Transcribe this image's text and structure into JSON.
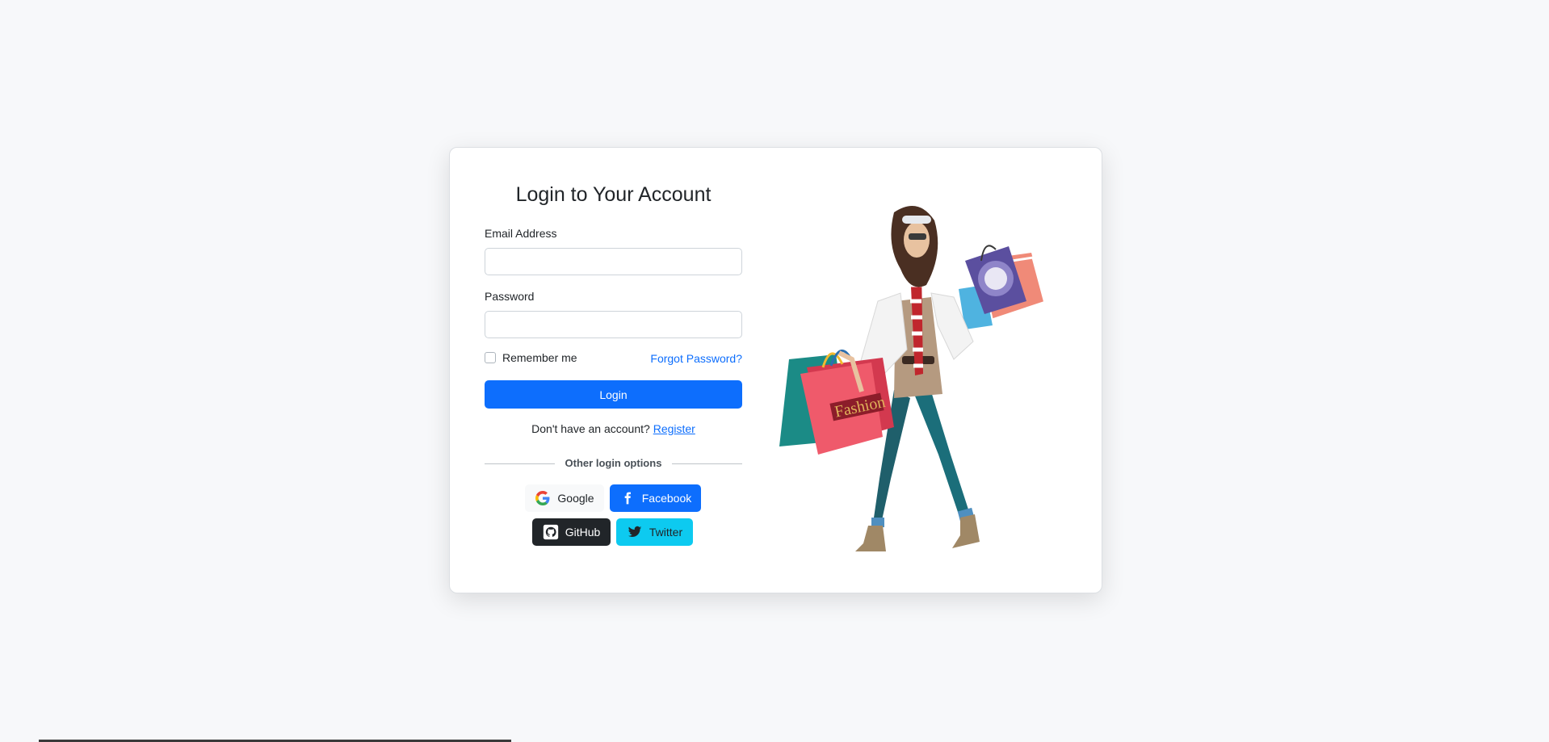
{
  "form": {
    "title": "Login to Your Account",
    "email_label": "Email Address",
    "email_value": "",
    "email_placeholder": "",
    "password_label": "Password",
    "password_value": "",
    "password_placeholder": "",
    "remember_label": "Remember me",
    "forgot_label": "Forgot Password?",
    "login_label": "Login",
    "no_account_text": "Don't have an account?",
    "register_label": "Register",
    "divider_text": "Other login options"
  },
  "social": {
    "google": {
      "label": "Google",
      "icon": "google-icon"
    },
    "facebook": {
      "label": "Facebook",
      "icon": "facebook-icon"
    },
    "github": {
      "label": "GitHub",
      "icon": "github-icon"
    },
    "twitter": {
      "label": "Twitter",
      "icon": "twitter-icon"
    }
  },
  "illustration": {
    "bag_text": "Fashion"
  },
  "colors": {
    "primary": "#0d6efd",
    "dark": "#212529",
    "info": "#0dcaf0",
    "light": "#f8f9fa",
    "page_bg": "#f7f8fa"
  }
}
